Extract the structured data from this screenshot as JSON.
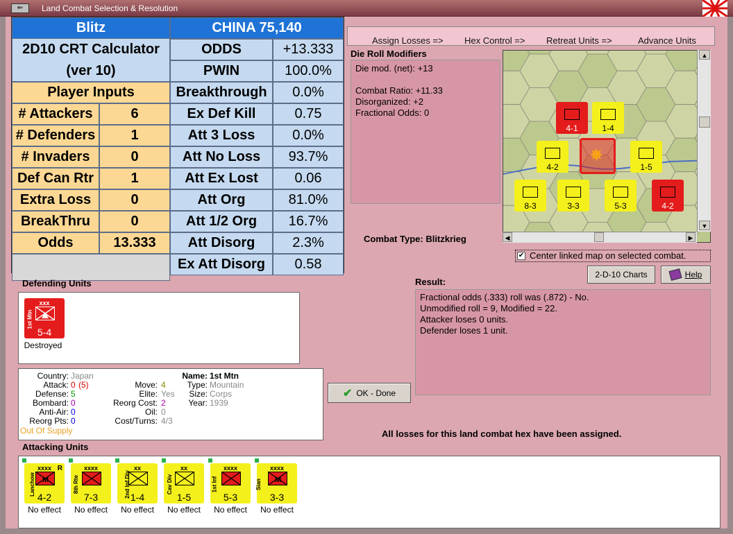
{
  "window": {
    "title": "Land Combat Selection & Resolution",
    "sys_icon": "⇐"
  },
  "steps": [
    "Assign Losses =>",
    "Hex Control =>",
    "Retreat Units =>",
    "Advance Units"
  ],
  "crt": {
    "title_left": "Blitz",
    "title_right": "CHINA 75,140",
    "calc_title": "2D10 CRT Calculator",
    "calc_version": "(ver 10)",
    "player_inputs": "Player Inputs",
    "inputs": [
      {
        "label": "# Attackers",
        "value": "6"
      },
      {
        "label": "# Defenders",
        "value": "1"
      },
      {
        "label": "# Invaders",
        "value": "0"
      },
      {
        "label": "Def Can Rtr",
        "value": "1"
      },
      {
        "label": "Extra Loss",
        "value": "0"
      },
      {
        "label": "BreakThru",
        "value": "0"
      },
      {
        "label": "Odds",
        "value": "13.333"
      }
    ],
    "outputs": [
      {
        "label": "ODDS",
        "value": "+13.333"
      },
      {
        "label": "PWIN",
        "value": "100.0%"
      },
      {
        "label": "Breakthrough",
        "value": "0.0%"
      },
      {
        "label": "Ex Def Kill",
        "value": "0.75"
      },
      {
        "label": "Att 3 Loss",
        "value": "0.0%"
      },
      {
        "label": "Att No Loss",
        "value": "93.7%"
      },
      {
        "label": "Att Ex Lost",
        "value": "0.06"
      },
      {
        "label": "Att Org",
        "value": "81.0%"
      },
      {
        "label": "Att 1/2 Org",
        "value": "16.7%"
      },
      {
        "label": "Att Disorg",
        "value": "2.3%"
      },
      {
        "label": "Ex Att Disorg",
        "value": "0.58"
      }
    ]
  },
  "die_roll": {
    "label": "Die Roll Modifiers",
    "lines": [
      "Die mod. (net): +13",
      "",
      "Combat Ratio: +11.33",
      "Disorganized: +2",
      "Fractional Odds: 0"
    ]
  },
  "combat_type": "Combat Type:  Blitzkrieg",
  "center_check": {
    "label": "Center linked map on selected combat.",
    "checked": "✔"
  },
  "buttons": {
    "charts": "2-D-10 Charts",
    "help": "Help",
    "ok": "OK - Done"
  },
  "result": {
    "label": "Result:",
    "lines": [
      "Fractional odds (.333) roll was (.872)  - No.",
      "Unmodified roll = 9, Modified = 22.",
      "Attacker loses 0 units.",
      "Defender loses 1 unit."
    ]
  },
  "defending": {
    "label": "Defending Units",
    "units": [
      {
        "type": "xxx",
        "name": "1st Mtn",
        "strength": "5-4",
        "status": "Destroyed"
      }
    ]
  },
  "info": {
    "country_label": "Country:",
    "country": "Japan",
    "attack_label": "Attack:",
    "attack": "0",
    "attack_paren": "(5)",
    "defense_label": "Defense:",
    "defense": "5",
    "bombard_label": "Bombard:",
    "bombard": "0",
    "antiair_label": "Anti-Air:",
    "antiair": "0",
    "reorg_label": "Reorg Pts:",
    "reorg": "0",
    "supply": "Out Of Supply",
    "move_label": "Move:",
    "move": "4",
    "elite_label": "Elite:",
    "elite": "Yes",
    "reorgcost_label": "Reorg Cost:",
    "reorgcost": "2",
    "oil_label": "Oil:",
    "oil": "0",
    "cost_label": "Cost/Turns:",
    "cost": "4/3",
    "name_label": "Name:",
    "name": "1st Mtn",
    "type_label": "Type:",
    "type": "Mountain",
    "size_label": "Size:",
    "size": "Corps",
    "year_label": "Year:",
    "year": "1939"
  },
  "all_losses": "All losses for this land combat hex have been assigned.",
  "attacking": {
    "label": "Attacking Units",
    "units": [
      {
        "type": "xxxx",
        "name": "Lanchow",
        "strength": "4-2",
        "flag": "R",
        "status": "No effect"
      },
      {
        "type": "xxxx",
        "name": "8th Rte",
        "strength": "7-3",
        "flag": "",
        "status": "No effect"
      },
      {
        "type": "xx",
        "name": "2nd Inf Div",
        "strength": "1-4",
        "flag": "",
        "status": "No effect"
      },
      {
        "type": "xx",
        "name": "Cav Div",
        "strength": "1-5",
        "flag": "",
        "status": "No effect"
      },
      {
        "type": "xxxx",
        "name": "1st Inf",
        "strength": "5-3",
        "flag": "",
        "status": "No effect"
      },
      {
        "type": "xxxx",
        "name": "Sian",
        "strength": "3-3",
        "flag": "",
        "status": "No effect"
      }
    ]
  },
  "map_units": [
    {
      "strength": "4-1",
      "kind": "red"
    },
    {
      "strength": "1-4",
      "kind": "yel"
    },
    {
      "strength": "4-2",
      "kind": "yel"
    },
    {
      "strength": "1-5",
      "kind": "yel"
    },
    {
      "strength": "8-3",
      "kind": "yel"
    },
    {
      "strength": "3-3",
      "kind": "yel"
    },
    {
      "strength": "5-3",
      "kind": "yel"
    },
    {
      "strength": "4-2",
      "kind": "red"
    }
  ],
  "colors": {
    "japan_red": "#e41c1c",
    "china_yellow": "#f4f01c",
    "crt_blue": "#1f73d6",
    "panel_pink": "#d796a6"
  }
}
